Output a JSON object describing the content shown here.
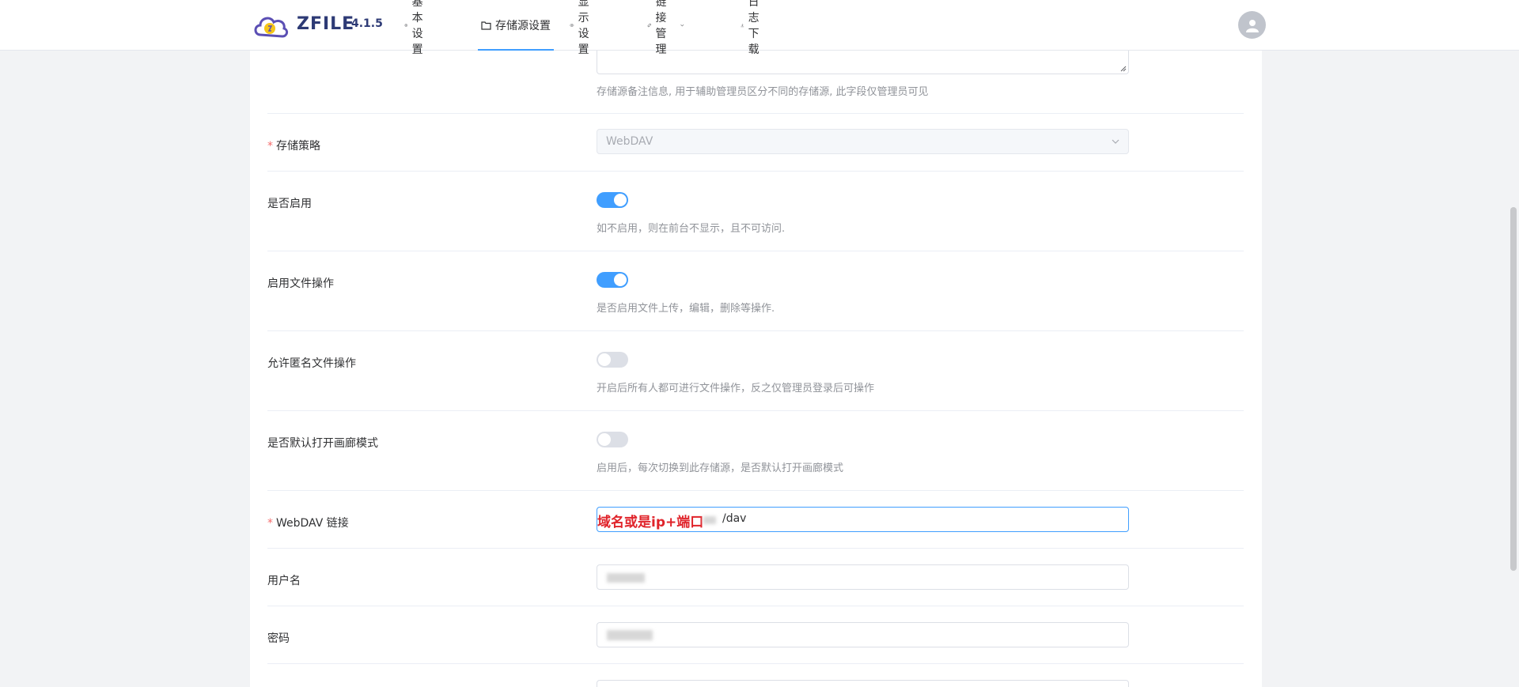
{
  "app": {
    "brand": "ZFILE",
    "version": "4.1.5"
  },
  "nav": [
    {
      "label": "基本设置",
      "icon": "gear-icon"
    },
    {
      "label": "存储源设置",
      "icon": "folder-icon",
      "active": true
    },
    {
      "label": "显示设置",
      "icon": "eye-icon"
    },
    {
      "label": "链接管理",
      "icon": "link-icon",
      "dropdown": true
    },
    {
      "label": "日志下载",
      "icon": "download-icon"
    }
  ],
  "form": {
    "remark_hint": "存储源备注信息, 用于辅助管理员区分不同的存储源, 此字段仅管理员可见",
    "strategy": {
      "label": "存储策略",
      "required": true,
      "value": "WebDAV"
    },
    "enabled": {
      "label": "是否启用",
      "on": true,
      "hint": "如不启用，则在前台不显示，且不可访问."
    },
    "file_ops": {
      "label": "启用文件操作",
      "on": true,
      "hint": "是否启用文件上传，编辑，删除等操作."
    },
    "anon_ops": {
      "label": "允许匿名文件操作",
      "on": false,
      "hint": "开启后所有人都可进行文件操作，反之仅管理员登录后可操作"
    },
    "gallery": {
      "label": "是否默认打开画廊模式",
      "on": false,
      "hint": "启用后，每次切换到此存储源，是否默认打开画廊模式"
    },
    "webdav_url": {
      "label": "WebDAV 链接",
      "required": true,
      "annotation": "域名或是ip+端口",
      "suffix": "/dav"
    },
    "username": {
      "label": "用户名"
    },
    "password": {
      "label": "密码"
    }
  },
  "colors": {
    "accent": "#409eff",
    "required": "#f56c6c",
    "annotation": "#e0242b"
  }
}
